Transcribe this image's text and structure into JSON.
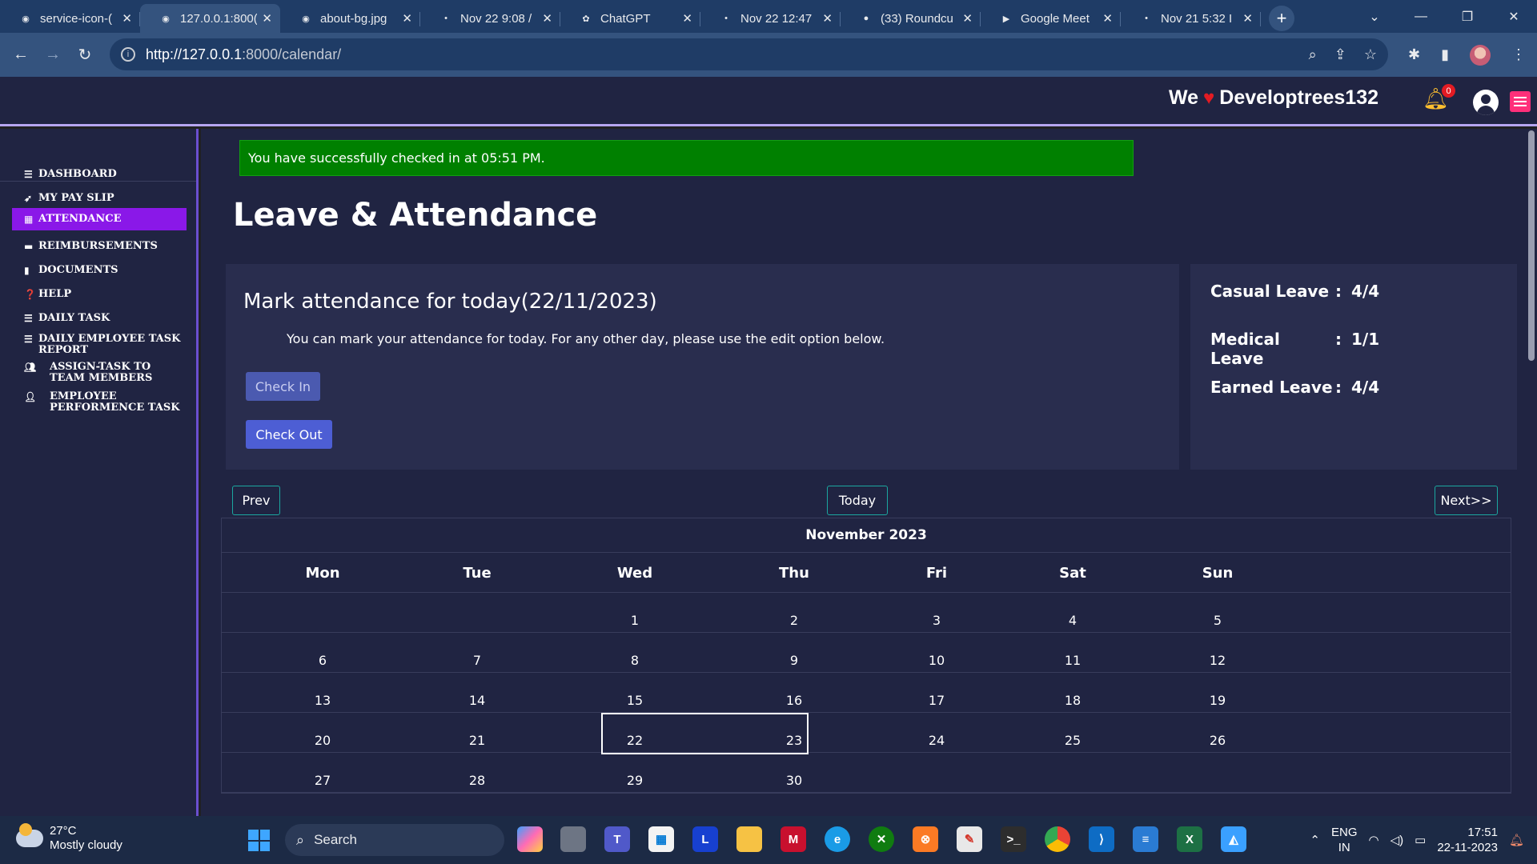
{
  "browser": {
    "tabs": [
      {
        "title": "service-icon-(",
        "active": false
      },
      {
        "title": "127.0.0.1:800(",
        "active": true
      },
      {
        "title": "about-bg.jpg",
        "active": false
      },
      {
        "title": "Nov 22 9:08 /",
        "active": false
      },
      {
        "title": "ChatGPT",
        "active": false
      },
      {
        "title": "Nov 22 12:47",
        "active": false
      },
      {
        "title": "(33) Roundcu",
        "active": false
      },
      {
        "title": "Google Meet",
        "active": false
      },
      {
        "title": "Nov 21 5:32 I",
        "active": false
      }
    ],
    "url_host": "http://127.0.0.1",
    "url_rest": ":8000/calendar/"
  },
  "header": {
    "brand_prefix": "We",
    "brand_name": "Developtrees132",
    "notification_count": "0"
  },
  "sidebar": {
    "items": [
      {
        "label": "DASHBOARD",
        "icon": "list-icon",
        "active": false
      },
      {
        "label": "MY PAY SLIP",
        "icon": "send-icon",
        "active": false
      },
      {
        "label": "ATTENDANCE",
        "icon": "calendar-icon",
        "active": true
      },
      {
        "label": "REIMBURSEMENTS",
        "icon": "card-icon",
        "active": false
      },
      {
        "label": "DOCUMENTS",
        "icon": "file-icon",
        "active": false
      },
      {
        "label": "HELP",
        "icon": "question-icon",
        "active": false
      },
      {
        "label": "DAILY TASK",
        "icon": "tasks-icon",
        "active": false
      },
      {
        "label": "DAILY EMPLOYEE TASK REPORT",
        "icon": "tasks-icon",
        "active": false
      },
      {
        "label": "ASSIGN-TASK TO TEAM MEMBERS",
        "icon": "users-icon",
        "active": false
      },
      {
        "label": "EMPLOYEE PERFORMENCE TASK",
        "icon": "user-gear-icon",
        "active": false
      }
    ]
  },
  "main": {
    "alert": "You have successfully checked in at 05:51 PM.",
    "title": "Leave & Attendance",
    "mark": {
      "heading": "Mark attendance for today(22/11/2023)",
      "note": "You can mark your attendance for today. For any other day, please use the edit option below.",
      "check_in_label": "Check In",
      "check_out_label": "Check Out"
    },
    "leaves": [
      {
        "name": "Casual Leave",
        "value": "4/4"
      },
      {
        "name": "Medical Leave",
        "value": "1/1"
      },
      {
        "name": "Earned Leave",
        "value": "4/4"
      }
    ],
    "calendar": {
      "prev_label": "Prev",
      "today_label": "Today",
      "next_label": "Next>>",
      "month": "November 2023",
      "weekdays": [
        "Mon",
        "Tue",
        "Wed",
        "Thu",
        "Fri",
        "Sat",
        "Sun"
      ],
      "weeks": [
        [
          "",
          "",
          "1",
          "2",
          "3",
          "4",
          "5"
        ],
        [
          "6",
          "7",
          "8",
          "9",
          "10",
          "11",
          "12"
        ],
        [
          "13",
          "14",
          "15",
          "16",
          "17",
          "18",
          "19"
        ],
        [
          "20",
          "21",
          "22",
          "23",
          "24",
          "25",
          "26"
        ],
        [
          "27",
          "28",
          "29",
          "30",
          "",
          "",
          ""
        ]
      ],
      "today": "22"
    }
  },
  "taskbar": {
    "weather_temp": "27°C",
    "weather_desc": "Mostly cloudy",
    "search_label": "Search",
    "lang_top": "ENG",
    "lang_bottom": "IN",
    "time": "17:51",
    "date": "22-11-2023"
  },
  "colors": {
    "app_bg": "#202442",
    "card_bg": "#292d4e",
    "accent_active": "#8a18e8",
    "alert_green": "#008000",
    "button_blue": "#4d5ed4",
    "outline_teal": "#1ba7a0"
  }
}
